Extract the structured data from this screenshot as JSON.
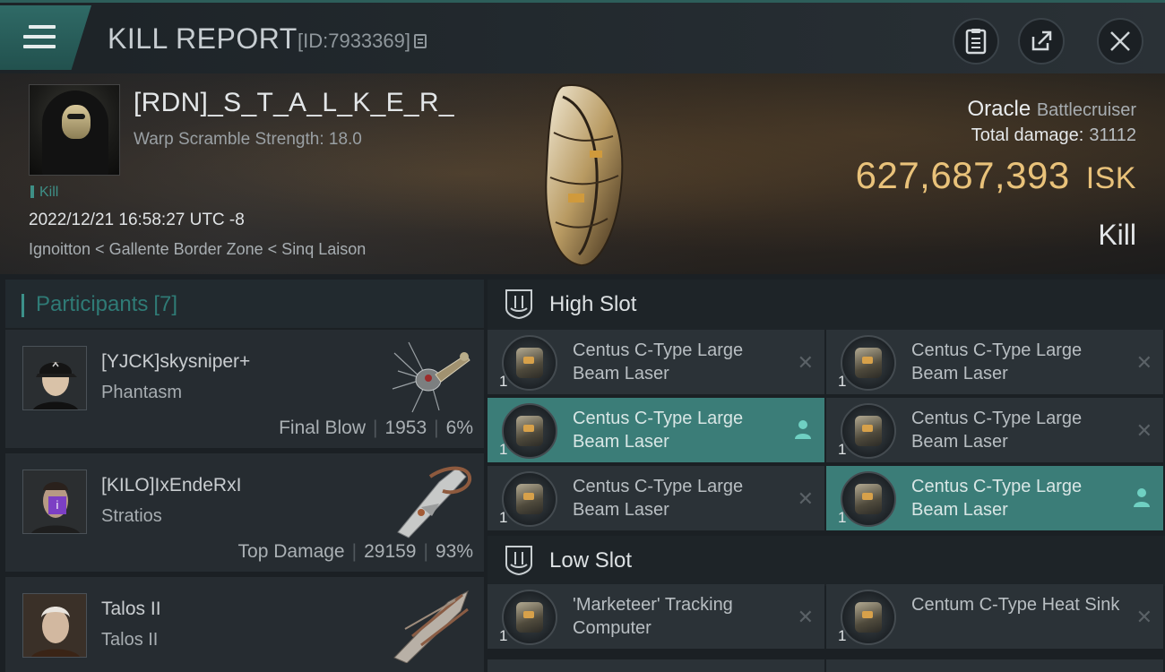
{
  "header": {
    "title": "KILL REPORT",
    "id_text": "[ID:7933369]",
    "icons": [
      "menu-icon",
      "copy-icon",
      "clipboard-icon",
      "share-icon",
      "close-icon"
    ]
  },
  "victim": {
    "name": "[RDN]_S_T_A_L_K_E_R_",
    "warp": "Warp Scramble Strength: 18.0",
    "tag": "Kill",
    "datetime": "2022/12/21 16:58:27 UTC -8",
    "location": "Ignoitton < Gallente Border Zone < Sinq Laison",
    "ship": "Oracle",
    "ship_class": "Battlecruiser",
    "total_damage_label": "Total damage:",
    "total_damage": "31112",
    "isk_value": "627,687,393",
    "isk_unit": "ISK",
    "result": "Kill"
  },
  "participants": {
    "label": "Participants",
    "count": "[7]",
    "items": [
      {
        "name": "[YJCK]skysniper+",
        "ship": "Phantasm",
        "stat_label": "Final Blow",
        "damage": "1953",
        "percent": "6%"
      },
      {
        "name": "[KILO]IxEndeRxI",
        "ship": "Stratios",
        "stat_label": "Top Damage",
        "damage": "29159",
        "percent": "93%"
      },
      {
        "name": "Talos II",
        "ship": "Talos II",
        "stat_label": "",
        "damage": "",
        "percent": ""
      }
    ]
  },
  "slots": {
    "high": {
      "title": "High Slot",
      "modules": [
        {
          "name": "Centus C-Type Large Beam Laser",
          "qty": "1",
          "state": "destroyed"
        },
        {
          "name": "Centus C-Type Large Beam Laser",
          "qty": "1",
          "state": "destroyed"
        },
        {
          "name": "Centus C-Type Large Beam Laser",
          "qty": "1",
          "state": "dropped"
        },
        {
          "name": "Centus C-Type Large Beam Laser",
          "qty": "1",
          "state": "destroyed"
        },
        {
          "name": "Centus C-Type Large Beam Laser",
          "qty": "1",
          "state": "destroyed"
        },
        {
          "name": "Centus C-Type Large Beam Laser",
          "qty": "1",
          "state": "dropped"
        }
      ]
    },
    "low": {
      "title": "Low Slot",
      "modules": [
        {
          "name": "'Marketeer' Tracking Computer",
          "qty": "1",
          "state": "destroyed"
        },
        {
          "name": "Centum C-Type Heat Sink",
          "qty": "1",
          "state": "destroyed"
        }
      ]
    }
  },
  "colors": {
    "accent": "#3b7d78",
    "isk": "#e9c27a",
    "panel": "#262c31"
  }
}
